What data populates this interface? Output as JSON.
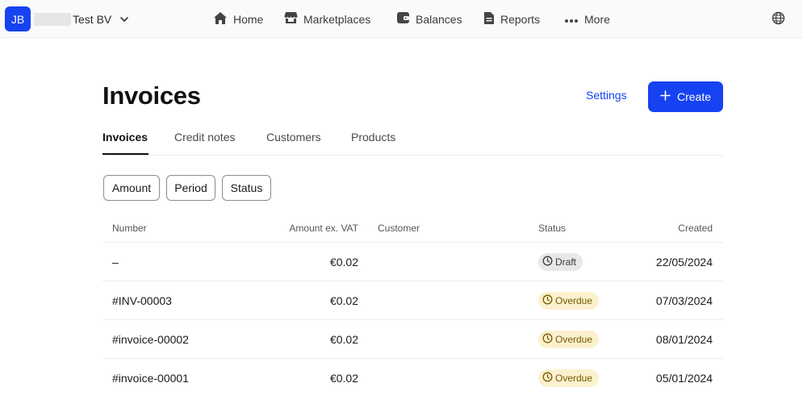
{
  "colors": {
    "accent": "#1642f2",
    "draft_bg": "#e8e8ea",
    "draft_fg": "#3a3a3a",
    "overdue_bg": "#fbf1cf",
    "overdue_fg": "#7a5a00"
  },
  "header": {
    "avatar_initials": "JB",
    "org_name": "Test BV",
    "nav": [
      {
        "label": "Home",
        "icon": "home-icon"
      },
      {
        "label": "Marketplaces",
        "icon": "store-icon"
      },
      {
        "label": "Balances",
        "icon": "wallet-icon"
      },
      {
        "label": "Reports",
        "icon": "document-icon"
      },
      {
        "label": "More",
        "icon": "more-dots-icon"
      }
    ],
    "language_icon": "globe-icon"
  },
  "page": {
    "title": "Invoices",
    "settings_label": "Settings",
    "create_label": "Create"
  },
  "tabs": [
    {
      "label": "Invoices",
      "active": true
    },
    {
      "label": "Credit notes",
      "active": false
    },
    {
      "label": "Customers",
      "active": false
    },
    {
      "label": "Products",
      "active": false
    }
  ],
  "filters": [
    "Amount",
    "Period",
    "Status"
  ],
  "table": {
    "columns": [
      "Number",
      "Amount ex. VAT",
      "Customer",
      "Status",
      "Created"
    ],
    "rows": [
      {
        "number": "–",
        "amount": "€0.02",
        "customer": "",
        "status": "Draft",
        "created": "22/05/2024"
      },
      {
        "number": "#INV-00003",
        "amount": "€0.02",
        "customer": "",
        "status": "Overdue",
        "created": "07/03/2024"
      },
      {
        "number": "#invoice-00002",
        "amount": "€0.02",
        "customer": "",
        "status": "Overdue",
        "created": "08/01/2024"
      },
      {
        "number": "#invoice-00001",
        "amount": "€0.02",
        "customer": "",
        "status": "Overdue",
        "created": "05/01/2024"
      }
    ]
  }
}
